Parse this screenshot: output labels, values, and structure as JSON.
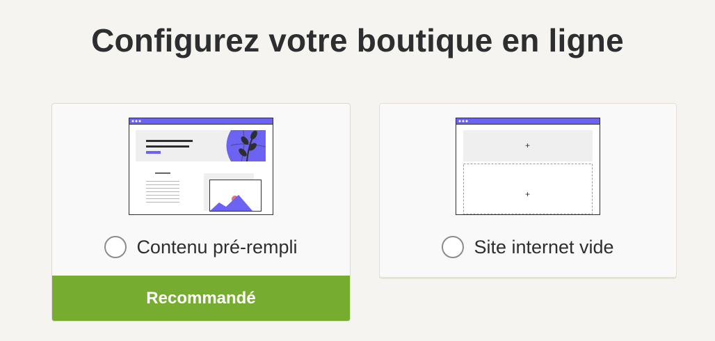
{
  "page": {
    "title": "Configurez votre boutique en ligne"
  },
  "options": [
    {
      "label": "Contenu pré-rempli",
      "badge": "Recommandé",
      "illustration": "prefilled-site-illustration",
      "selected": false
    },
    {
      "label": "Site internet vide",
      "illustration": "empty-site-illustration",
      "selected": false,
      "placeholder_symbol": "+"
    }
  ],
  "colors": {
    "accent_purple": "#6d63f2",
    "recommended_green": "#76ad31",
    "background": "#f6f4f1"
  }
}
